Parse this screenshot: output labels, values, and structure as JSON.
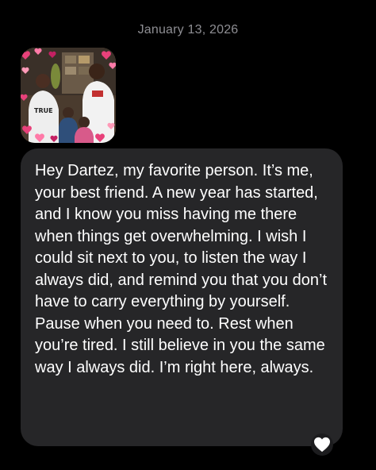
{
  "conversation": {
    "date_header": "January 13, 2026"
  },
  "attachment": {
    "type": "photo",
    "description_icon": "family-photo-image",
    "frame_icon": "hearts-frame-icon"
  },
  "message": {
    "text": "Hey Dartez, my favorite person. It’s me, your best friend. A new year has started, and I know you miss having me there when things get overwhelming. I wish I could sit next to you, to listen the way I always did, and remind you that you don’t have to carry everything by yourself. Pause when you need to. Rest when you’re tired. I still believe in you the same way I always did. I’m right here, always.",
    "reaction_icon": "heart-icon"
  },
  "colors": {
    "background": "#000000",
    "bubble": "#262628",
    "date_text": "#8e8e93",
    "message_text": "#ffffff",
    "reaction": "#ffffff"
  }
}
